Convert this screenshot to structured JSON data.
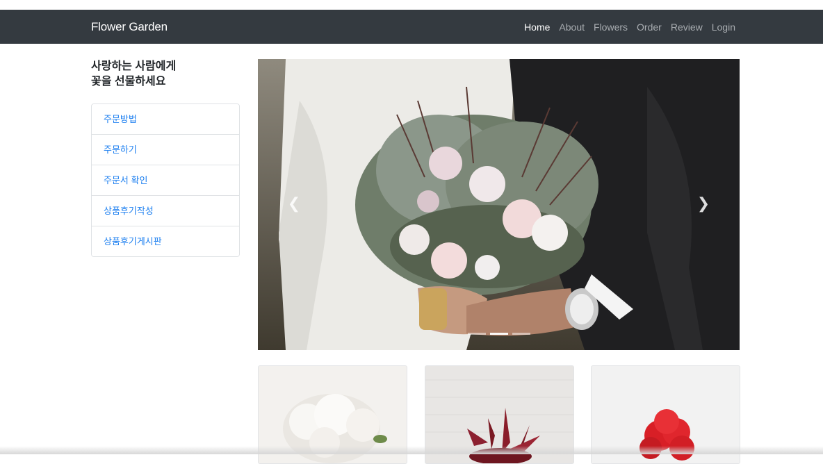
{
  "navbar": {
    "brand": "Flower Garden",
    "links": [
      {
        "label": "Home",
        "active": true
      },
      {
        "label": "About",
        "active": false
      },
      {
        "label": "Flowers",
        "active": false
      },
      {
        "label": "Order",
        "active": false
      },
      {
        "label": "Review",
        "active": false
      },
      {
        "label": "Login",
        "active": false
      }
    ]
  },
  "sidebar": {
    "tagline_line1": "사랑하는 사람에게",
    "tagline_line2": "꽃을 선물하세요",
    "items": [
      {
        "label": "주문방법"
      },
      {
        "label": "주문하기"
      },
      {
        "label": "주문서 확인"
      },
      {
        "label": "상품후기작성"
      },
      {
        "label": "상품후기게시판"
      }
    ]
  },
  "carousel": {
    "prev_icon": "chevron-left-icon",
    "next_icon": "chevron-right-icon",
    "indicator_count": 3,
    "active_indicator": 2
  },
  "colors": {
    "navbar_bg": "#343a40",
    "link": "#1a7ef0"
  }
}
